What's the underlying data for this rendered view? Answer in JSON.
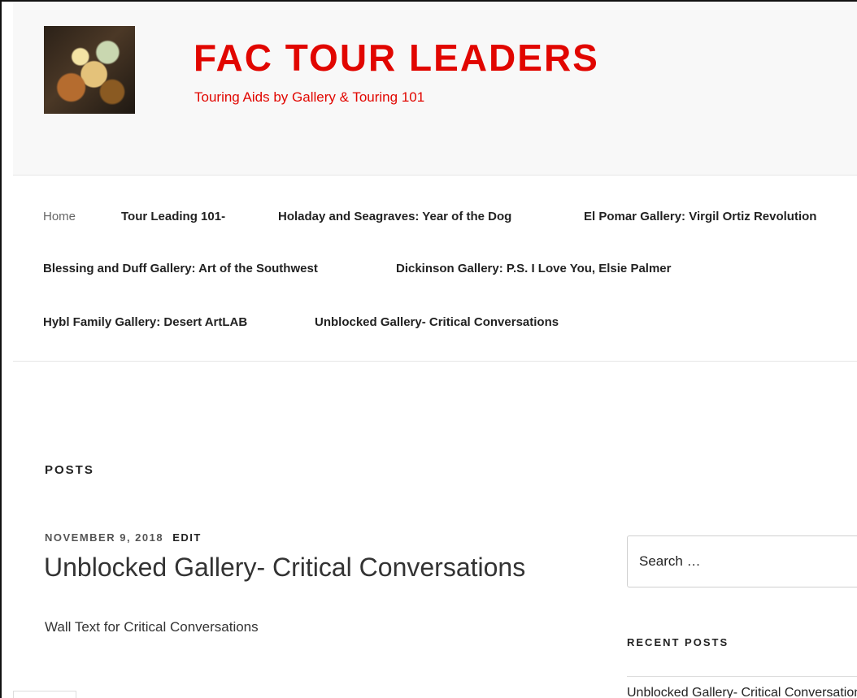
{
  "header": {
    "site_title": "FAC TOUR LEADERS",
    "tagline": "Touring Aids by Gallery & Touring 101",
    "logo_icon": "glass-sculpture-logo"
  },
  "nav": {
    "items": [
      {
        "label": "Home"
      },
      {
        "label": "Tour Leading 101-"
      },
      {
        "label": "Holaday and Seagraves: Year of the Dog"
      },
      {
        "label": "El Pomar Gallery: Virgil Ortiz Revolution"
      },
      {
        "label": "Blessing and Duff Gallery: Art of the Southwest"
      },
      {
        "label": "Dickinson Gallery: P.S. I Love You, Elsie Palmer"
      },
      {
        "label": "Hybl Family Gallery: Desert ArtLAB"
      },
      {
        "label": "Unblocked Gallery- Critical Conversations"
      }
    ]
  },
  "main": {
    "heading": "POSTS",
    "post": {
      "date": "NOVEMBER 9, 2018",
      "edit_label": "EDIT",
      "title": "Unblocked Gallery- Critical Conversations",
      "excerpt": "Wall Text for Critical Conversations"
    }
  },
  "sidebar": {
    "search_placeholder": "Search …",
    "recent_heading": "RECENT POSTS",
    "recent_items": [
      {
        "label": "Unblocked Gallery- Critical Conversations"
      }
    ]
  },
  "colors": {
    "brand": "#e10600",
    "text": "#222222",
    "header_bg": "#f8f8f8"
  }
}
